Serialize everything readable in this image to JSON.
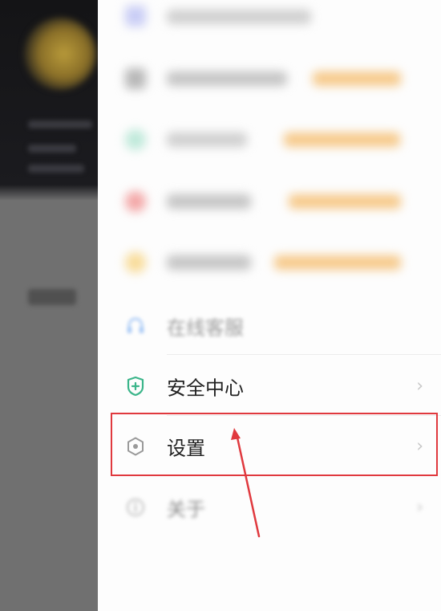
{
  "menu": {
    "items": [
      {
        "id": "online_support",
        "label": "在线客服",
        "icon": "headset-icon",
        "visible_state": "partially-blurred"
      },
      {
        "id": "security_center",
        "label": "安全中心",
        "icon": "shield-plus-icon",
        "chevron": "›"
      },
      {
        "id": "settings",
        "label": "设置",
        "icon": "hexagon-gear-icon",
        "chevron": "›",
        "highlighted": true
      },
      {
        "id": "about",
        "label": "关于",
        "icon": "info-circle-icon",
        "chevron": "›",
        "visible_state": "blurred"
      }
    ]
  },
  "annotation": {
    "highlight_color": "#e0393e",
    "target": "settings"
  },
  "colors": {
    "security_icon": "#3bb58a",
    "settings_icon": "#9a9a9a",
    "blur_orange": "#f6c98a",
    "blur_red": "#f3a7a7",
    "blur_blue": "#9ec3f5",
    "blur_green": "#bfe9da"
  }
}
